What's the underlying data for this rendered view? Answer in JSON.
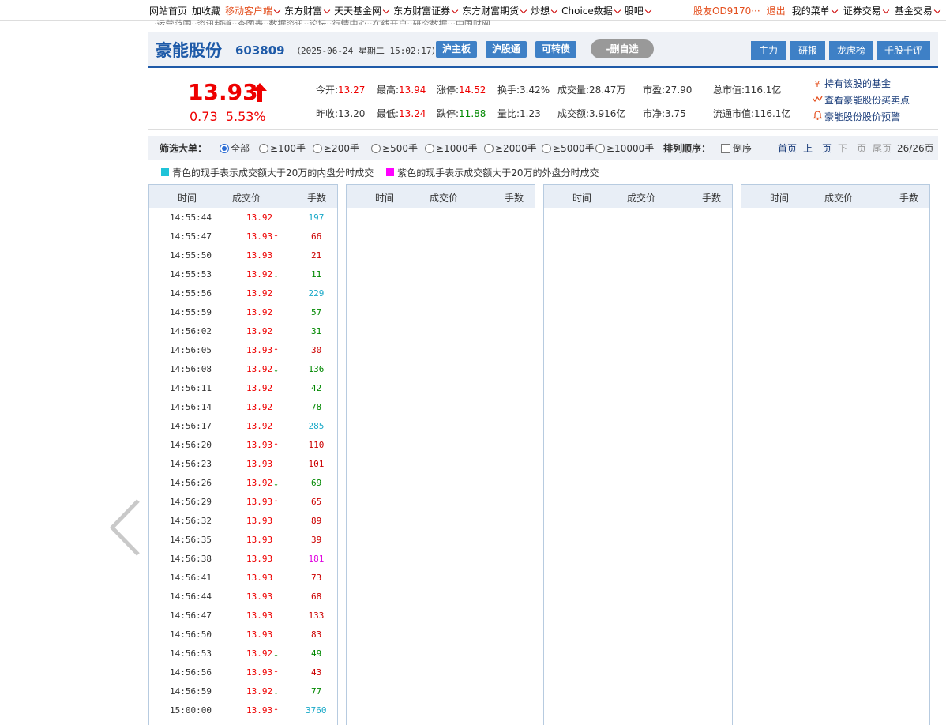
{
  "topnav": {
    "left": [
      {
        "label": "网站首页",
        "hl": false,
        "chev": false
      },
      {
        "label": "加收藏",
        "hl": false,
        "chev": false
      },
      {
        "label": "移动客户端",
        "hl": true,
        "chev": true
      },
      {
        "label": "东方财富",
        "hl": false,
        "chev": true
      },
      {
        "label": "天天基金网",
        "hl": false,
        "chev": true
      },
      {
        "label": "东方财富证券",
        "hl": false,
        "chev": true
      },
      {
        "label": "东方财富期货",
        "hl": false,
        "chev": true
      },
      {
        "label": "炒想",
        "hl": false,
        "chev": true
      },
      {
        "label": "Choice数据",
        "hl": false,
        "chev": true
      },
      {
        "label": "股吧",
        "hl": false,
        "chev": true
      }
    ],
    "user": "股友OD9170···",
    "logout": "退出",
    "right": [
      {
        "label": "我的菜单"
      },
      {
        "label": "证券交易"
      },
      {
        "label": "基金交易"
      }
    ]
  },
  "substrip": "·运营范围··资讯频道··查图表··数据资讯··论坛··行情中心··在线开户··研究数据···中国财网",
  "stock": {
    "name": "豪能股份",
    "code": "603809",
    "time": "（2025-06-24 星期二 15:02:17）",
    "tags": [
      "沪主板",
      "沪股通",
      "可转债"
    ],
    "del_fav": "-删自选",
    "right_buttons": [
      "主力",
      "研报",
      "龙虎榜",
      "千股千评"
    ]
  },
  "quote": {
    "price": "13.93",
    "change": "0.73",
    "change_pct": "5.53%",
    "row1": [
      {
        "label": "今开:",
        "value": "13.27",
        "color": "red"
      },
      {
        "label": "最高:",
        "value": "13.94",
        "color": "red"
      },
      {
        "label": "涨停:",
        "value": "14.52",
        "color": "red"
      },
      {
        "label": "换手:",
        "value": "3.42%",
        "color": ""
      },
      {
        "label": "成交量:",
        "value": "28.47万",
        "color": ""
      },
      {
        "label": "市盈:",
        "value": "27.90",
        "color": ""
      },
      {
        "label": "总市值:",
        "value": "116.1亿",
        "color": ""
      }
    ],
    "row2": [
      {
        "label": "昨收:",
        "value": "13.20",
        "color": ""
      },
      {
        "label": "最低:",
        "value": "13.24",
        "color": "red"
      },
      {
        "label": "跌停:",
        "value": "11.88",
        "color": "green"
      },
      {
        "label": "量比:",
        "value": "1.23",
        "color": ""
      },
      {
        "label": "成交额:",
        "value": "3.916亿",
        "color": ""
      },
      {
        "label": "市净:",
        "value": "3.75",
        "color": ""
      },
      {
        "label": "流通市值:",
        "value": "116.1亿",
        "color": ""
      }
    ],
    "links": [
      {
        "icon": "yen-icon",
        "label": "持有该股的基金"
      },
      {
        "icon": "chart-icon",
        "label": "查看豪能股份买卖点"
      },
      {
        "icon": "bell-icon",
        "label": "豪能股份股价预警"
      }
    ]
  },
  "filter": {
    "label": "筛选大单：",
    "options": [
      "全部",
      "≥100手",
      "≥200手",
      "≥500手",
      "≥1000手",
      "≥2000手",
      "≥5000手",
      "≥10000手"
    ],
    "selected": 0,
    "sort_label": "排列顺序：",
    "reverse": "倒序",
    "first": "首页",
    "prev": "上一页",
    "next": "下一页",
    "last": "尾页",
    "page": "26/26页"
  },
  "legend": {
    "cyan": "青色的现手表示成交额大于20万的内盘分时成交",
    "magenta": "紫色的现手表示成交额大于20万的外盘分时成交",
    "cyan_color": "#1fc3d8",
    "magenta_color": "#ff00ff"
  },
  "table_headers": [
    "时间",
    "成交价",
    "手数"
  ],
  "trades": [
    {
      "time": "14:55:44",
      "price": "13.92",
      "arrow": "",
      "vol": "197",
      "vc": "cyan"
    },
    {
      "time": "14:55:47",
      "price": "13.93",
      "arrow": "up",
      "vol": "66",
      "vc": "red"
    },
    {
      "time": "14:55:50",
      "price": "13.93",
      "arrow": "",
      "vol": "21",
      "vc": "red"
    },
    {
      "time": "14:55:53",
      "price": "13.92",
      "arrow": "dn",
      "vol": "11",
      "vc": "green"
    },
    {
      "time": "14:55:56",
      "price": "13.92",
      "arrow": "",
      "vol": "229",
      "vc": "cyan"
    },
    {
      "time": "14:55:59",
      "price": "13.92",
      "arrow": "",
      "vol": "57",
      "vc": "green"
    },
    {
      "time": "14:56:02",
      "price": "13.92",
      "arrow": "",
      "vol": "31",
      "vc": "green"
    },
    {
      "time": "14:56:05",
      "price": "13.93",
      "arrow": "up",
      "vol": "30",
      "vc": "red"
    },
    {
      "time": "14:56:08",
      "price": "13.92",
      "arrow": "dn",
      "vol": "136",
      "vc": "green"
    },
    {
      "time": "14:56:11",
      "price": "13.92",
      "arrow": "",
      "vol": "42",
      "vc": "green"
    },
    {
      "time": "14:56:14",
      "price": "13.92",
      "arrow": "",
      "vol": "78",
      "vc": "green"
    },
    {
      "time": "14:56:17",
      "price": "13.92",
      "arrow": "",
      "vol": "285",
      "vc": "cyan"
    },
    {
      "time": "14:56:20",
      "price": "13.93",
      "arrow": "up",
      "vol": "110",
      "vc": "red"
    },
    {
      "time": "14:56:23",
      "price": "13.93",
      "arrow": "",
      "vol": "101",
      "vc": "red"
    },
    {
      "time": "14:56:26",
      "price": "13.92",
      "arrow": "dn",
      "vol": "69",
      "vc": "green"
    },
    {
      "time": "14:56:29",
      "price": "13.93",
      "arrow": "up",
      "vol": "65",
      "vc": "red"
    },
    {
      "time": "14:56:32",
      "price": "13.93",
      "arrow": "",
      "vol": "89",
      "vc": "red"
    },
    {
      "time": "14:56:35",
      "price": "13.93",
      "arrow": "",
      "vol": "39",
      "vc": "red"
    },
    {
      "time": "14:56:38",
      "price": "13.93",
      "arrow": "",
      "vol": "181",
      "vc": "mag"
    },
    {
      "time": "14:56:41",
      "price": "13.93",
      "arrow": "",
      "vol": "73",
      "vc": "red"
    },
    {
      "time": "14:56:44",
      "price": "13.93",
      "arrow": "",
      "vol": "68",
      "vc": "red"
    },
    {
      "time": "14:56:47",
      "price": "13.93",
      "arrow": "",
      "vol": "133",
      "vc": "red"
    },
    {
      "time": "14:56:50",
      "price": "13.93",
      "arrow": "",
      "vol": "83",
      "vc": "red"
    },
    {
      "time": "14:56:53",
      "price": "13.92",
      "arrow": "dn",
      "vol": "49",
      "vc": "green"
    },
    {
      "time": "14:56:56",
      "price": "13.93",
      "arrow": "up",
      "vol": "43",
      "vc": "red"
    },
    {
      "time": "14:56:59",
      "price": "13.92",
      "arrow": "dn",
      "vol": "77",
      "vc": "green"
    },
    {
      "time": "15:00:00",
      "price": "13.93",
      "arrow": "up",
      "vol": "3760",
      "vc": "cyan"
    }
  ]
}
